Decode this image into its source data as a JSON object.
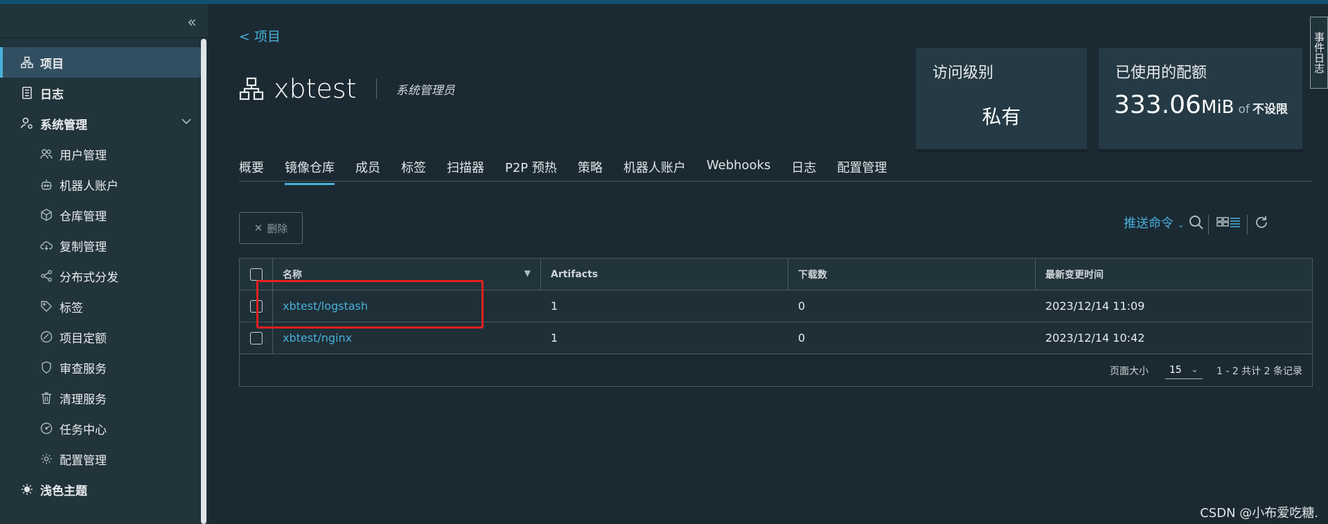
{
  "sidebar": {
    "collapse_icon": "double-chevron-left-icon",
    "items": [
      {
        "label": "项目",
        "icon": "project-icon",
        "active": true
      },
      {
        "label": "日志",
        "icon": "log-icon"
      },
      {
        "label": "系统管理",
        "icon": "system-admin-icon",
        "expanded": true
      },
      {
        "label": "用户管理",
        "icon": "users-icon"
      },
      {
        "label": "机器人账户",
        "icon": "robot-icon"
      },
      {
        "label": "仓库管理",
        "icon": "cube-icon"
      },
      {
        "label": "复制管理",
        "icon": "cloud-icon"
      },
      {
        "label": "分布式分发",
        "icon": "share-icon"
      },
      {
        "label": "标签",
        "icon": "tag-icon"
      },
      {
        "label": "项目定额",
        "icon": "quota-icon"
      },
      {
        "label": "审查服务",
        "icon": "shield-icon"
      },
      {
        "label": "清理服务",
        "icon": "trash-icon"
      },
      {
        "label": "任务中心",
        "icon": "dashboard-icon"
      },
      {
        "label": "配置管理",
        "icon": "gear-icon"
      },
      {
        "label": "浅色主题",
        "icon": "sun-icon"
      }
    ]
  },
  "header": {
    "back_label": "< 项目",
    "project_name": "xbtest",
    "role": "系统管理员"
  },
  "cards": {
    "access_label": "访问级别",
    "access_value": "私有",
    "quota_label": "已使用的配额",
    "quota_value": "333.06",
    "quota_unit": "MiB",
    "quota_of": "of",
    "quota_limit": "不设限"
  },
  "side_tab": "事件日志",
  "tabs": [
    "概要",
    "镜像仓库",
    "成员",
    "标签",
    "扫描器",
    "P2P 预热",
    "策略",
    "机器人账户",
    "Webhooks",
    "日志",
    "配置管理"
  ],
  "active_tab": "镜像仓库",
  "toolbar": {
    "delete_label": "删除",
    "push_command_label": "推送命令"
  },
  "table": {
    "columns": [
      "名称",
      "Artifacts",
      "下载数",
      "最新变更时间"
    ],
    "rows": [
      {
        "name": "xbtest/logstash",
        "artifacts": "1",
        "downloads": "0",
        "updated": "2023/12/14 11:09"
      },
      {
        "name": "xbtest/nginx",
        "artifacts": "1",
        "downloads": "0",
        "updated": "2023/12/14 10:42"
      }
    ],
    "page_size_label": "页面大小",
    "page_size": "15",
    "count_label": "1 - 2 共计 2 条记录"
  },
  "watermark": "CSDN @小布爱吃糖.",
  "colors": {
    "accent": "#49afd9",
    "highlight": "#e8201f",
    "background": "#1b2a32",
    "sidebar": "#21333b"
  }
}
